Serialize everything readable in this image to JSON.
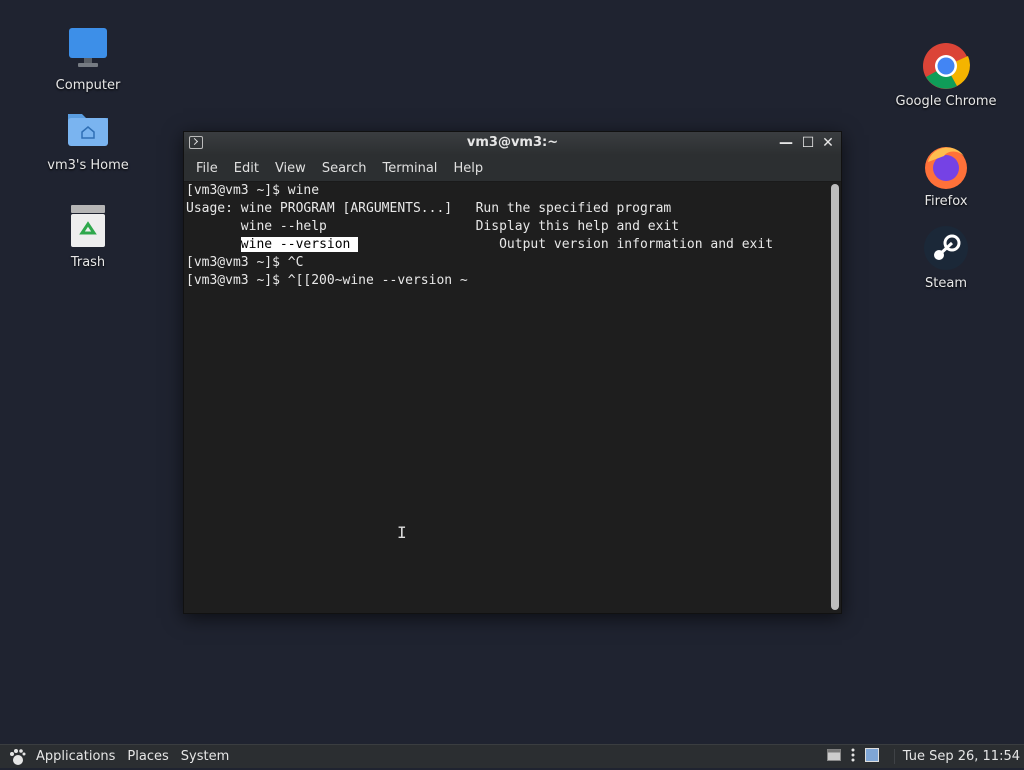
{
  "desktop": {
    "icons_left": [
      {
        "label": "Computer"
      },
      {
        "label": "vm3's Home"
      },
      {
        "label": "Trash"
      }
    ],
    "icons_right": [
      {
        "label": "Google Chrome"
      },
      {
        "label": "Firefox"
      },
      {
        "label": "Steam"
      }
    ]
  },
  "terminal": {
    "title": "vm3@vm3:~",
    "menu": [
      "File",
      "Edit",
      "View",
      "Search",
      "Terminal",
      "Help"
    ],
    "lines": [
      "[vm3@vm3 ~]$ wine",
      "Usage: wine PROGRAM [ARGUMENTS...]   Run the specified program",
      "       wine --help                   Display this help and exit",
      "       ",
      "[vm3@vm3 ~]$ ^C",
      "[vm3@vm3 ~]$ ^[[200~wine --version ~"
    ],
    "selected_text": "wine --version ",
    "selected_line_rest": "                  Output version information and exit",
    "window_buttons": {
      "minimize": "—",
      "maximize": "☐",
      "close": "✕"
    }
  },
  "panel": {
    "menus": [
      "Applications",
      "Places",
      "System"
    ],
    "clock": "Tue Sep 26, 11:54"
  },
  "colors": {
    "desktop_bg": "#1f2330",
    "terminal_bg": "#1e1e1e",
    "selection_bg": "#ffffff"
  }
}
